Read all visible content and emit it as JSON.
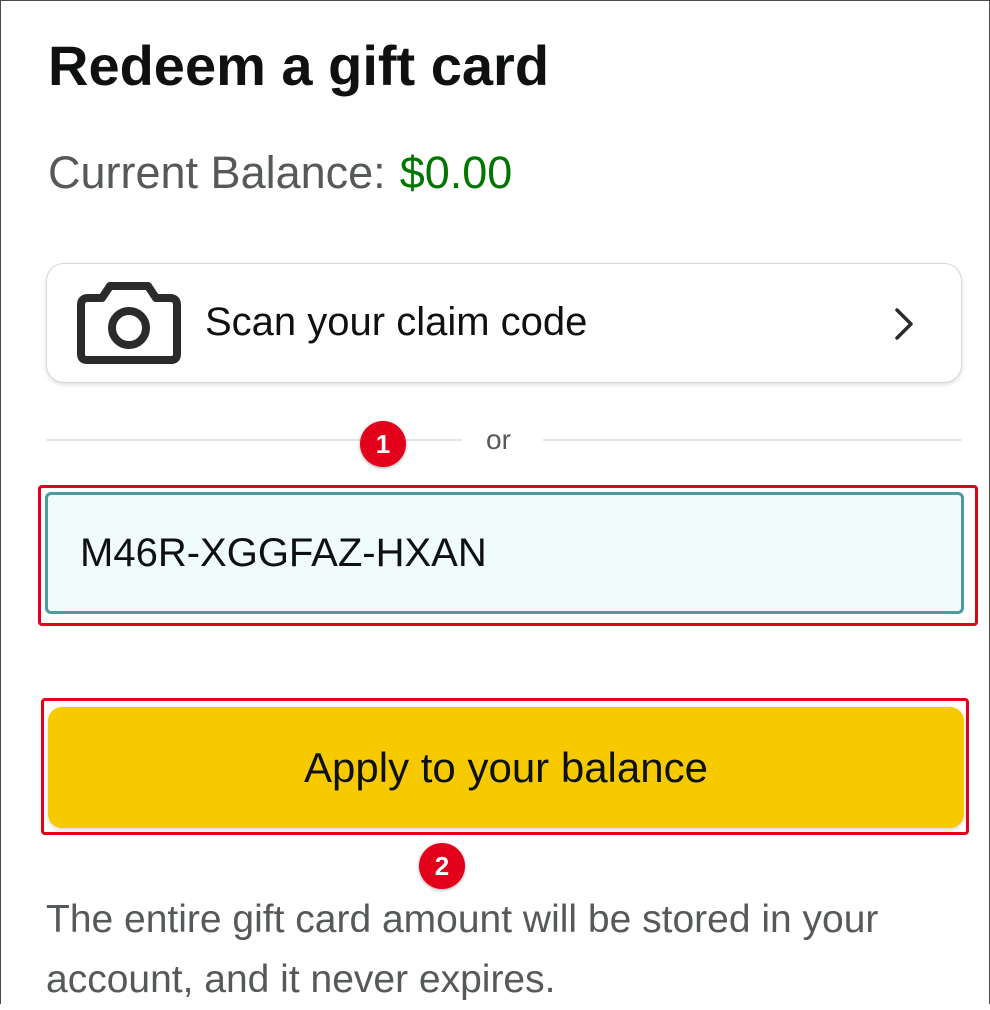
{
  "page": {
    "title": "Redeem a gift card",
    "balance_label": "Current Balance:",
    "balance_value": "$0.00"
  },
  "scan": {
    "label": "Scan your claim code",
    "icon": "camera-icon",
    "chevron_icon": "chevron-right-icon"
  },
  "divider": {
    "text": "or"
  },
  "claim_input": {
    "value": "M46R-XGGFAZ-HXAN"
  },
  "apply_button": {
    "label": "Apply to your balance"
  },
  "note": "The entire gift card amount will be stored in your account, and it never expires.",
  "annotations": {
    "marker_1": "1",
    "marker_2": "2",
    "highlight_color": "#e2001a"
  },
  "colors": {
    "balance_amount": "#007600",
    "apply_button": "#f7ca00",
    "input_border": "#4f9a9a"
  }
}
